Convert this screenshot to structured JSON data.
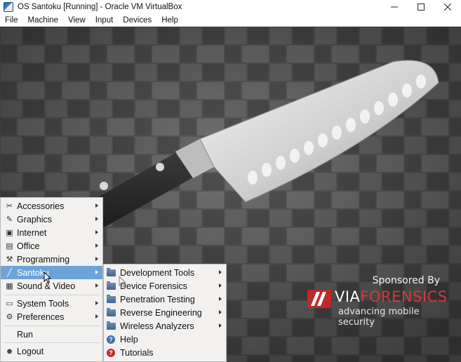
{
  "window": {
    "title": "OS Santoku [Running] - Oracle VM VirtualBox",
    "app_icon": "virtualbox-icon",
    "controls": [
      "minimize-icon",
      "maximize-icon",
      "close-icon"
    ]
  },
  "menubar": {
    "items": [
      "File",
      "Machine",
      "View",
      "Input",
      "Devices",
      "Help"
    ]
  },
  "main_menu": {
    "items": [
      {
        "label": "Accessories",
        "icon": "accessories-icon",
        "submenu": true
      },
      {
        "label": "Graphics",
        "icon": "graphics-icon",
        "submenu": true
      },
      {
        "label": "Internet",
        "icon": "internet-icon",
        "submenu": true
      },
      {
        "label": "Office",
        "icon": "office-icon",
        "submenu": true
      },
      {
        "label": "Programming",
        "icon": "programming-icon",
        "submenu": true
      },
      {
        "label": "Santoku",
        "icon": "santoku-icon",
        "submenu": true,
        "active": true
      },
      {
        "label": "Sound & Video",
        "icon": "sound-video-icon",
        "submenu": true
      },
      {
        "label": "System Tools",
        "icon": "system-tools-icon",
        "submenu": true
      },
      {
        "label": "Preferences",
        "icon": "preferences-icon",
        "submenu": true
      },
      {
        "label": "Run",
        "icon": "",
        "submenu": false
      },
      {
        "label": "Logout",
        "icon": "logout-icon",
        "submenu": false
      }
    ]
  },
  "sub_menu": {
    "items": [
      {
        "label": "Development Tools",
        "icon": "folder-icon",
        "submenu": true
      },
      {
        "label": "Device Forensics",
        "icon": "folder-icon",
        "submenu": true
      },
      {
        "label": "Penetration Testing",
        "icon": "folder-icon",
        "submenu": true
      },
      {
        "label": "Reverse Engineering",
        "icon": "folder-icon",
        "submenu": true
      },
      {
        "label": "Wireless Analyzers",
        "icon": "folder-icon",
        "submenu": true
      },
      {
        "label": "Help",
        "icon": "help-icon",
        "submenu": false
      },
      {
        "label": "Tutorials",
        "icon": "tutorials-icon",
        "submenu": false
      }
    ]
  },
  "sponsor": {
    "sponsored_by": "Sponsored By",
    "brand_via": "VIA",
    "brand_forensics": "FORENSICS",
    "tagline": "advancing mobile security"
  },
  "colors": {
    "menu_bg": "#f2f1f0",
    "highlight": "#6ea3d8",
    "brand_red": "#c0282a"
  }
}
